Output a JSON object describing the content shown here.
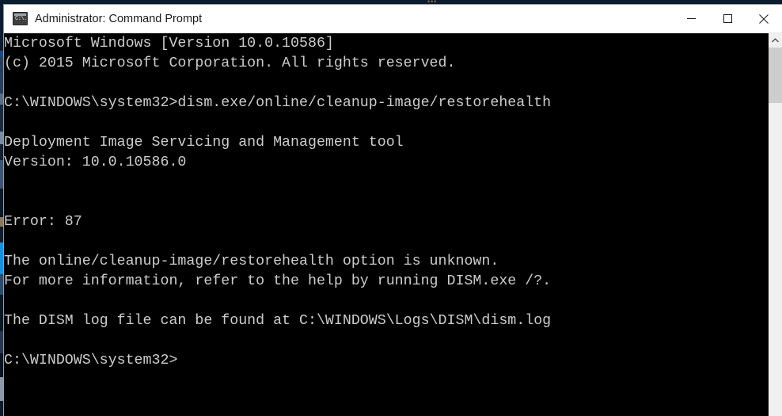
{
  "window": {
    "title": "Administrator: Command Prompt",
    "icon_name": "command-prompt-icon",
    "icon_glyph": "C:\\.",
    "controls": {
      "minimize_label": "Minimize",
      "maximize_label": "Maximize",
      "close_label": "Close"
    }
  },
  "desktop": {
    "top_band_hint": "•••"
  },
  "terminal": {
    "background_color": "#000000",
    "text_color": "#cccccc",
    "prompt_path": "C:\\WINDOWS\\system32>",
    "lines": [
      "Microsoft Windows [Version 10.0.10586]",
      "(c) 2015 Microsoft Corporation. All rights reserved.",
      "",
      "C:\\WINDOWS\\system32>dism.exe/online/cleanup-image/restorehealth",
      "",
      "Deployment Image Servicing and Management tool",
      "Version: 10.0.10586.0",
      "",
      "",
      "Error: 87",
      "",
      "The online/cleanup-image/restorehealth option is unknown.",
      "For more information, refer to the help by running DISM.exe /?.",
      "",
      "The DISM log file can be found at C:\\WINDOWS\\Logs\\DISM\\dism.log",
      "",
      "C:\\WINDOWS\\system32>"
    ],
    "text_block": "Microsoft Windows [Version 10.0.10586]\n(c) 2015 Microsoft Corporation. All rights reserved.\n\nC:\\WINDOWS\\system32>dism.exe/online/cleanup-image/restorehealth\n\nDeployment Image Servicing and Management tool\nVersion: 10.0.10586.0\n\n\nError: 87\n\nThe online/cleanup-image/restorehealth option is unknown.\nFor more information, refer to the help by running DISM.exe /?.\n\nThe DISM log file can be found at C:\\WINDOWS\\Logs\\DISM\\dism.log\n\nC:\\WINDOWS\\system32>",
    "command_entered": "dism.exe/online/cleanup-image/restorehealth",
    "error_code": "87",
    "tool_name": "Deployment Image Servicing and Management tool",
    "tool_version": "10.0.10586.0",
    "log_path": "C:\\WINDOWS\\Logs\\DISM\\dism.log",
    "os_version": "10.0.10586"
  },
  "scrollbar": {
    "up_arrow_name": "scroll-up-arrow",
    "thumb_name": "scroll-thumb"
  }
}
